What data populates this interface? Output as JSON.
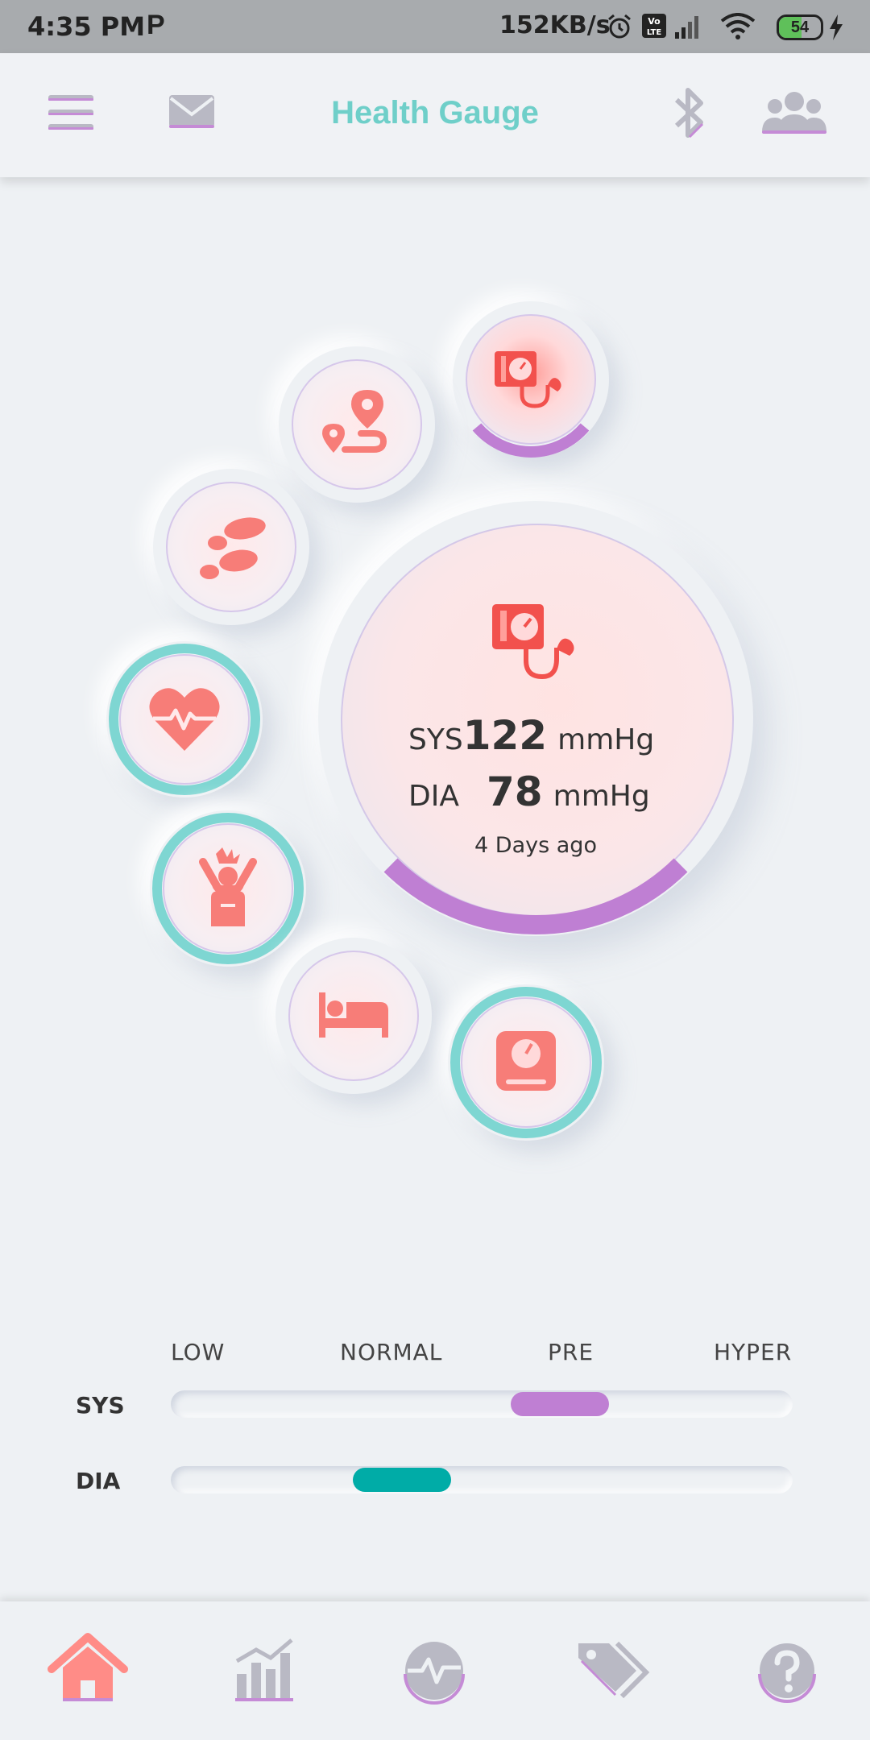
{
  "status_bar": {
    "time": "4:35 PM",
    "app_glyph": "P",
    "speed": "152KB/s",
    "battery_level": "54",
    "icons": [
      "alarm-icon",
      "volte-icon",
      "signal-icon",
      "wifi-icon",
      "battery-icon",
      "charging-icon"
    ]
  },
  "header": {
    "title": "Health Gauge",
    "icons": [
      "menu-icon",
      "mail-icon",
      "bluetooth-icon",
      "people-icon"
    ]
  },
  "main_gauge": {
    "sys_label": "SYS",
    "sys_value": "122",
    "dia_label": "DIA",
    "dia_value": "78",
    "unit": "mmHg",
    "last_measured": "4 Days ago",
    "icon": "blood-pressure-icon"
  },
  "gauges": [
    {
      "name": "blood-pressure",
      "icon": "blood-pressure-icon",
      "selected": true
    },
    {
      "name": "route",
      "icon": "route-icon"
    },
    {
      "name": "steps",
      "icon": "footsteps-icon"
    },
    {
      "name": "heart-rate",
      "icon": "heart-rate-icon"
    },
    {
      "name": "stress",
      "icon": "stress-icon"
    },
    {
      "name": "sleep",
      "icon": "bed-icon"
    },
    {
      "name": "weight",
      "icon": "scale-icon"
    }
  ],
  "levels": {
    "headings": [
      "LOW",
      "NORMAL",
      "PRE",
      "HYPER"
    ],
    "sys_label": "SYS",
    "dia_label": "DIA",
    "sys_position": 0.62,
    "dia_position": 0.37
  },
  "bottom_nav": {
    "items": [
      "home-icon",
      "chart-icon",
      "activity-icon",
      "tags-icon",
      "help-icon"
    ],
    "active": "home-icon"
  },
  "colors": {
    "accent_teal": "#6fcfc9",
    "accent_purple": "#bf7fd3",
    "icon_coral": "#f2716d",
    "dia_thumb": "#00aca7"
  }
}
